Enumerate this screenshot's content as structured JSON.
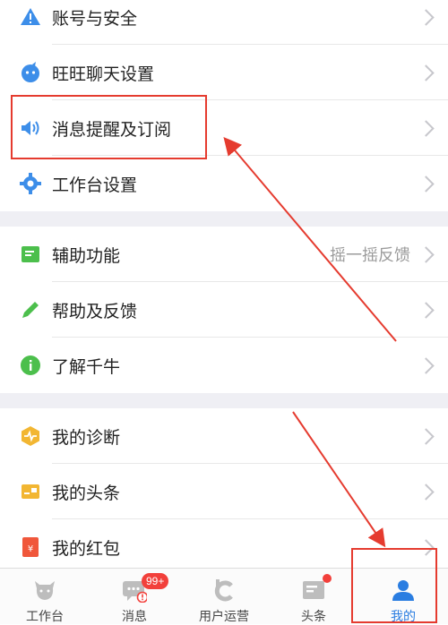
{
  "settings": {
    "items": [
      {
        "label": "账号与安全"
      },
      {
        "label": "旺旺聊天设置"
      },
      {
        "label": "消息提醒及订阅"
      },
      {
        "label": "工作台设置"
      },
      {
        "label": "辅助功能",
        "value": "摇一摇反馈"
      },
      {
        "label": "帮助及反馈"
      },
      {
        "label": "了解千牛"
      },
      {
        "label": "我的诊断"
      },
      {
        "label": "我的头条"
      },
      {
        "label": "我的红包"
      }
    ]
  },
  "tabbar": {
    "tabs": [
      {
        "label": "工作台"
      },
      {
        "label": "消息",
        "badge": "99+"
      },
      {
        "label": "用户运营"
      },
      {
        "label": "头条"
      },
      {
        "label": "我的"
      }
    ]
  },
  "colors": {
    "accent": "#2a7de1",
    "annotation": "#e53b2f",
    "badge": "#f2403b",
    "section_gap": "#efeff4"
  }
}
